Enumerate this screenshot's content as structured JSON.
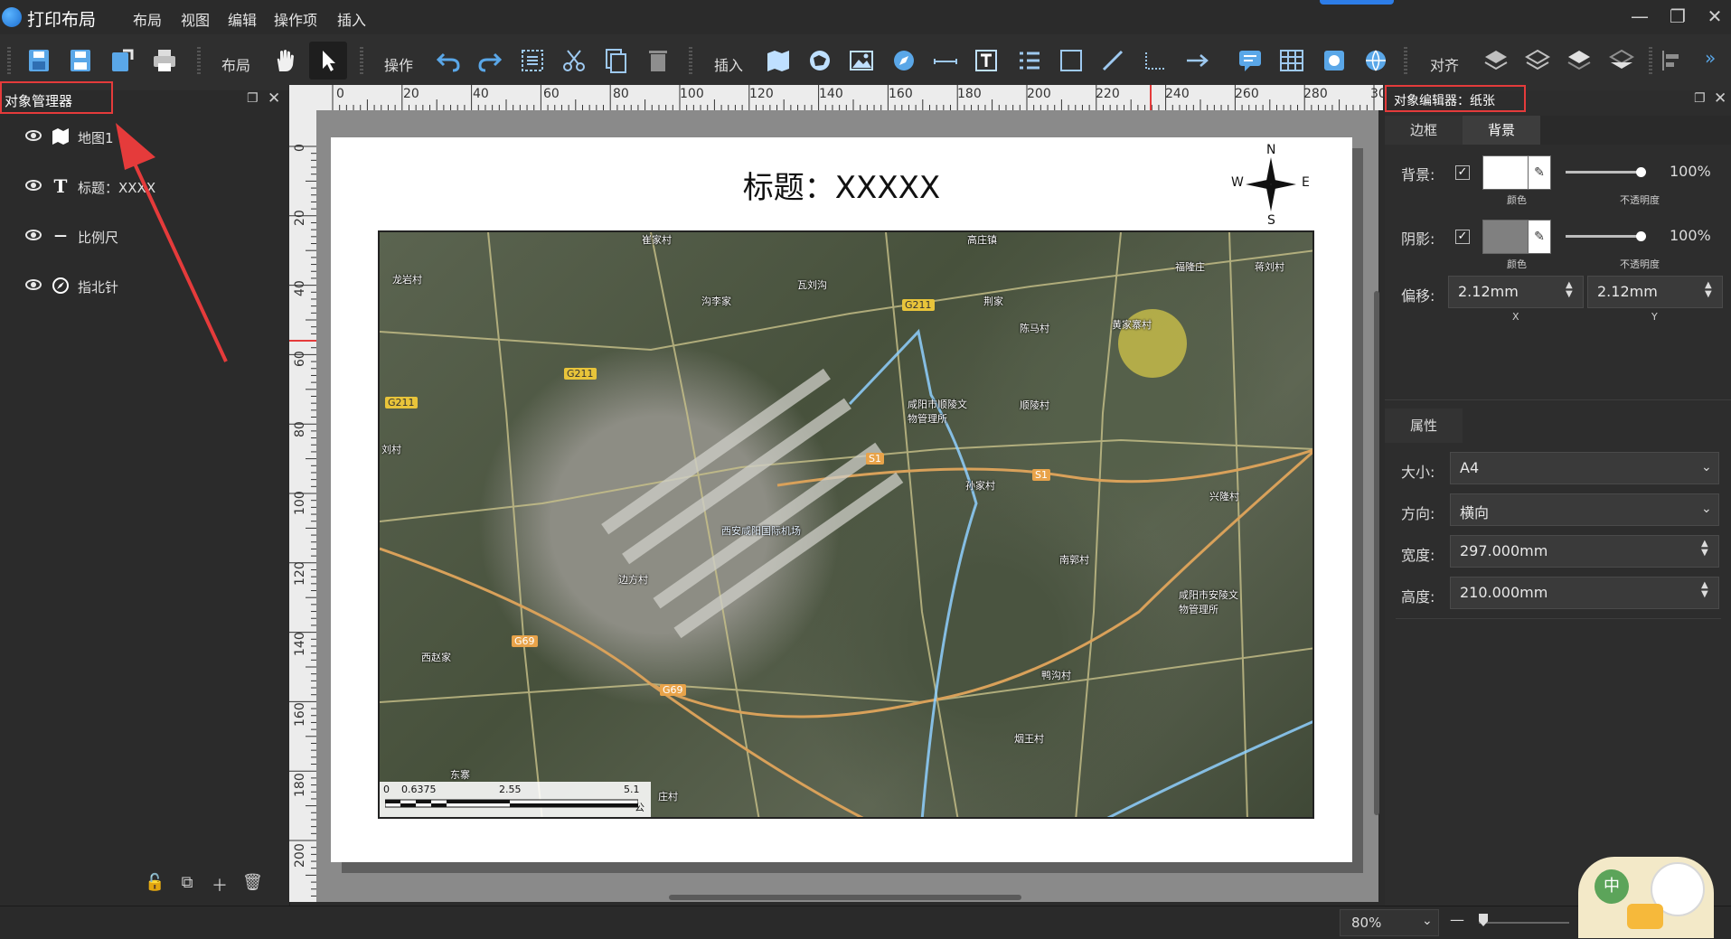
{
  "app": {
    "title": "打印布局"
  },
  "menu": [
    "布局",
    "视图",
    "编辑",
    "操作项",
    "插入"
  ],
  "toolbar": {
    "labels": {
      "layout": "布局",
      "operation": "操作",
      "insert": "插入",
      "align": "对齐"
    }
  },
  "object_manager": {
    "title": "对象管理器",
    "items": [
      {
        "label": "地图1",
        "icon": "map-icon"
      },
      {
        "label": "标题：XXXX",
        "icon": "text-icon"
      },
      {
        "label": "比例尺",
        "icon": "scalebar-icon"
      },
      {
        "label": "指北针",
        "icon": "compass-icon"
      }
    ]
  },
  "ruler": {
    "h": [
      "0",
      "20",
      "40",
      "60",
      "80",
      "100",
      "120",
      "140",
      "160",
      "180",
      "200",
      "220",
      "240",
      "260",
      "280",
      "30"
    ],
    "v": [
      "0",
      "20",
      "40",
      "60",
      "80",
      "100",
      "120",
      "140",
      "160",
      "180",
      "200"
    ]
  },
  "layout": {
    "title": "标题：XXXXX",
    "north": {
      "n": "N",
      "s": "S",
      "w": "W",
      "e": "E"
    },
    "scalebar": {
      "ticks": [
        "0",
        "0.6375",
        "2.55",
        "5.1"
      ],
      "unit": "公里"
    },
    "map_labels": [
      "崔家村",
      "高庄镇",
      "福隆庄",
      "蒋刘村",
      "龙岩村",
      "沟李家",
      "瓦刘沟",
      "荆家",
      "陈马村",
      "黄家寨村",
      "咸阳市顺陵文物管理所",
      "顺陵村",
      "西安咸阳国际机场",
      "孙家村",
      "兴隆村",
      "边方村",
      "南郭村",
      "咸阳市安陵文物管理所",
      "西赵家",
      "鸭沟村",
      "烟王村",
      "东寨",
      "庄村",
      "刘村"
    ],
    "road_labels": [
      "G211",
      "G211",
      "G211",
      "S1",
      "S1",
      "G69",
      "G69"
    ]
  },
  "object_editor": {
    "title": "对象编辑器：纸张",
    "tabs": [
      "边框",
      "背景"
    ],
    "background": {
      "label": "背景:",
      "color_caption": "颜色",
      "opacity_caption": "不透明度",
      "opacity": "100%",
      "checked": true,
      "color": "#ffffff"
    },
    "shadow": {
      "label": "阴影:",
      "color_caption": "颜色",
      "opacity_caption": "不透明度",
      "opacity": "100%",
      "checked": true,
      "color": "#808080"
    },
    "offset": {
      "label": "偏移:",
      "x": "2.12mm",
      "y": "2.12mm",
      "x_caption": "X",
      "y_caption": "Y"
    },
    "properties": {
      "title": "属性",
      "size_label": "大小:",
      "size": "A4",
      "orientation_label": "方向:",
      "orientation": "横向",
      "width_label": "宽度:",
      "width": "297.000mm",
      "height_label": "高度:",
      "height": "210.000mm"
    }
  },
  "status": {
    "zoom": "80%",
    "ime": "中"
  },
  "colors": {
    "accent": "#2d7de8",
    "highlight": "#e53b3b"
  }
}
